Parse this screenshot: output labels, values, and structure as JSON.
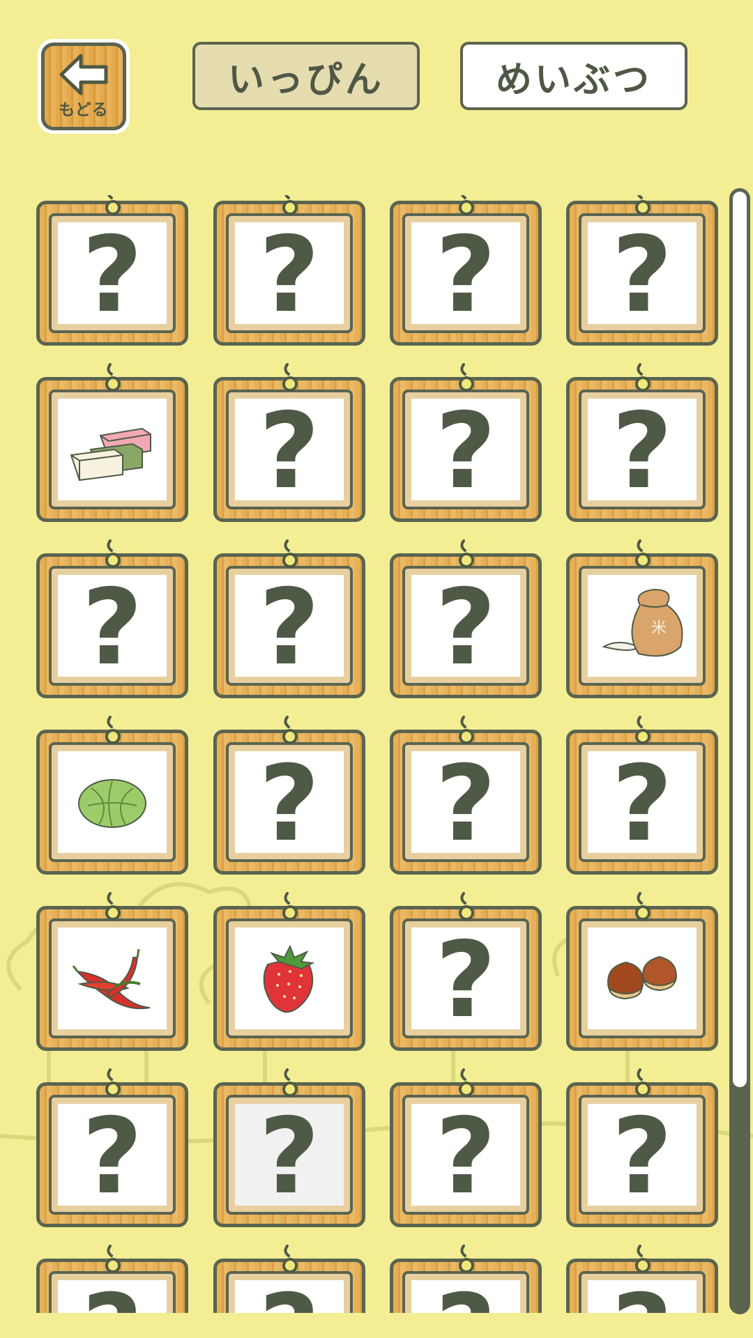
{
  "header": {
    "back_label": "もどる",
    "tabs": [
      {
        "label": "いっぴん",
        "active": true
      },
      {
        "label": "めいぶつ",
        "active": false
      }
    ]
  },
  "cards": [
    {
      "item": "unknown"
    },
    {
      "item": "unknown"
    },
    {
      "item": "unknown"
    },
    {
      "item": "unknown"
    },
    {
      "item": "three-color-dango-blocks"
    },
    {
      "item": "unknown"
    },
    {
      "item": "unknown"
    },
    {
      "item": "unknown"
    },
    {
      "item": "unknown"
    },
    {
      "item": "unknown"
    },
    {
      "item": "unknown"
    },
    {
      "item": "rice-sack"
    },
    {
      "item": "cabbage"
    },
    {
      "item": "unknown"
    },
    {
      "item": "unknown"
    },
    {
      "item": "unknown"
    },
    {
      "item": "chili-peppers"
    },
    {
      "item": "strawberry"
    },
    {
      "item": "unknown"
    },
    {
      "item": "chestnuts"
    },
    {
      "item": "unknown"
    },
    {
      "item": "unknown",
      "selected": true
    },
    {
      "item": "unknown"
    },
    {
      "item": "unknown"
    },
    {
      "item": "unknown"
    },
    {
      "item": "unknown"
    },
    {
      "item": "unknown"
    },
    {
      "item": "unknown"
    }
  ],
  "unknown_symbol": "?",
  "scrollbar": {
    "thumb_fraction": 0.8
  },
  "colors": {
    "background": "#f3ee94",
    "ink": "#5a6450",
    "wood": "#e6b058"
  }
}
